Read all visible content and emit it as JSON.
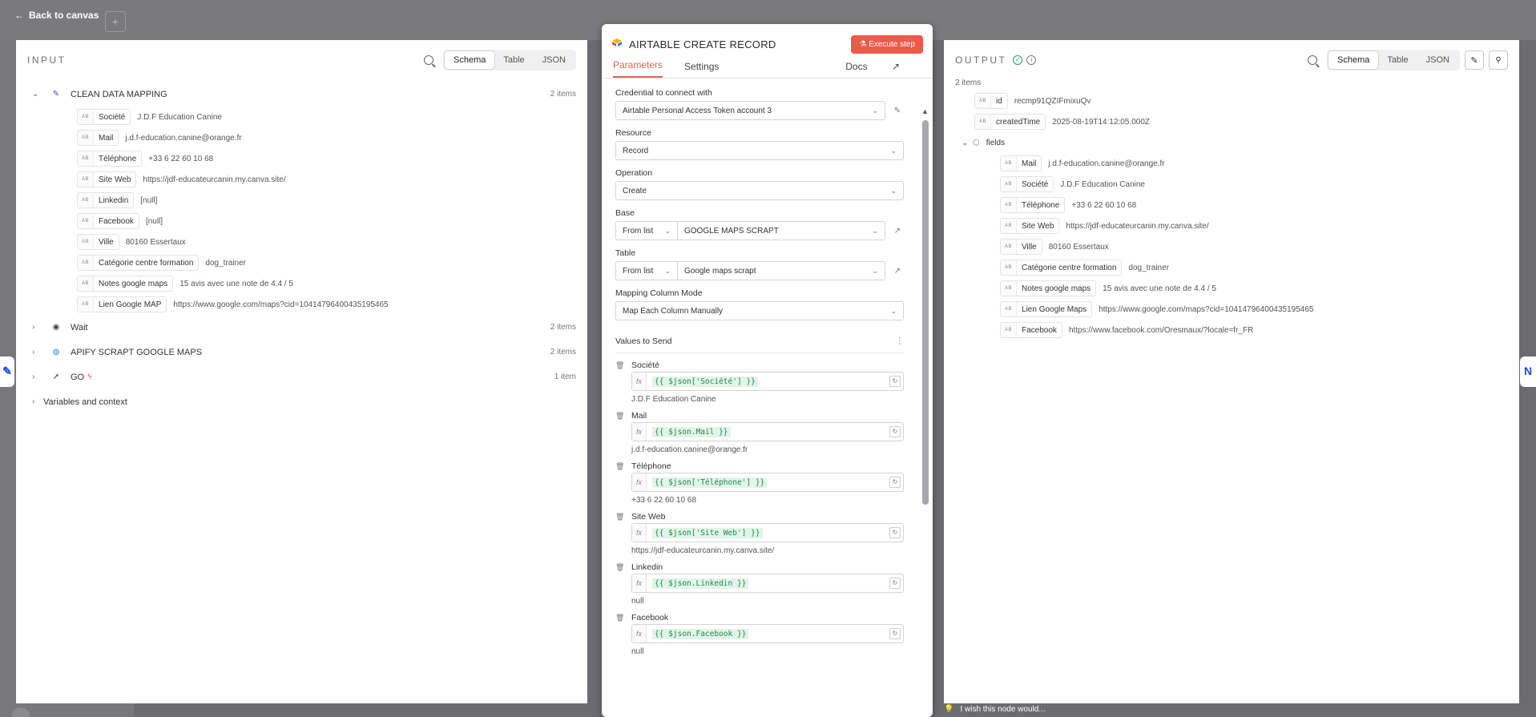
{
  "nav": {
    "back_label": "Back to canvas"
  },
  "input": {
    "title": "INPUT",
    "view_tabs": [
      "Schema",
      "Table",
      "JSON"
    ],
    "active_tab": "Schema",
    "nodes": [
      {
        "name": "CLEAN DATA MAPPING",
        "count": "2 items",
        "expanded": true,
        "icon": "pencil-icon",
        "fields": [
          {
            "key": "Société",
            "value": "J.D.F Education Canine"
          },
          {
            "key": "Mail",
            "value": "j.d.f-education.canine@orange.fr"
          },
          {
            "key": "Téléphone",
            "value": "+33 6 22 60 10 68"
          },
          {
            "key": "Site Web",
            "value": "https://jdf-educateurcanin.my.canva.site/"
          },
          {
            "key": "Linkedin",
            "value": "[null]"
          },
          {
            "key": "Facebook",
            "value": "[null]"
          },
          {
            "key": "Ville",
            "value": "80160 Essertaux"
          },
          {
            "key": "Catégorie centre formation",
            "value": "dog_trainer"
          },
          {
            "key": "Notes google maps",
            "value": "15 avis avec une note de 4.4 / 5"
          },
          {
            "key": "Lien Google MAP",
            "value": "https://www.google.com/maps?cid=10414796400435195465"
          }
        ]
      },
      {
        "name": "Wait",
        "count": "2 items",
        "icon": "wait-icon"
      },
      {
        "name": "APIFY SCRAPT GOOGLE MAPS",
        "count": "2 items",
        "icon": "globe-icon"
      },
      {
        "name": "GO",
        "count": "1 item",
        "icon": "cursor-icon"
      }
    ],
    "variables_label": "Variables and context"
  },
  "node": {
    "title": "AIRTABLE CREATE RECORD",
    "execute_label": "Execute step",
    "tabs": [
      "Parameters",
      "Settings"
    ],
    "docs_label": "Docs",
    "credential_label": "Credential to connect with",
    "credential_value": "Airtable Personal Access Token account 3",
    "resource_label": "Resource",
    "resource_value": "Record",
    "operation_label": "Operation",
    "operation_value": "Create",
    "base_label": "Base",
    "base_mode": "From list",
    "base_value": "GOOGLE MAPS SCRAPT",
    "table_label": "Table",
    "table_mode": "From list",
    "table_value": "Google maps scrapt",
    "mapping_label": "Mapping Column Mode",
    "mapping_value": "Map Each Column Manually",
    "values_label": "Values to Send",
    "values": [
      {
        "name": "Société",
        "expr": "{{ $json['Société'] }}",
        "preview": "J.D.F Education Canine"
      },
      {
        "name": "Mail",
        "expr": "{{ $json.Mail }}",
        "preview": "j.d.f-education.canine@orange.fr"
      },
      {
        "name": "Téléphone",
        "expr": "{{ $json['Téléphone'] }}",
        "preview": "+33 6 22 60 10 68"
      },
      {
        "name": "Site Web",
        "expr": "{{ $json['Site Web'] }}",
        "preview": "https://jdf-educateurcanin.my.canva.site/"
      },
      {
        "name": "Linkedin",
        "expr": "{{ $json.Linkedin }}",
        "preview": "null"
      },
      {
        "name": "Facebook",
        "expr": "{{ $json.Facebook }}",
        "preview": "null"
      }
    ]
  },
  "output": {
    "title": "OUTPUT",
    "view_tabs": [
      "Schema",
      "Table",
      "JSON"
    ],
    "active_tab": "Schema",
    "items_count": "2 items",
    "top_fields": [
      {
        "key": "id",
        "value": "recmp91QZIFmixuQv"
      },
      {
        "key": "createdTime",
        "value": "2025-08-19T14:12:05.000Z"
      }
    ],
    "fields_label": "fields",
    "fields": [
      {
        "key": "Mail",
        "value": "j.d.f-education.canine@orange.fr"
      },
      {
        "key": "Société",
        "value": "J.D.F Education Canine"
      },
      {
        "key": "Téléphone",
        "value": "+33 6 22 60 10 68"
      },
      {
        "key": "Site Web",
        "value": "https://jdf-educateurcanin.my.canva.site/"
      },
      {
        "key": "Ville",
        "value": "80160 Essertaux"
      },
      {
        "key": "Catégorie centre formation",
        "value": "dog_trainer"
      },
      {
        "key": "Notes google maps",
        "value": "15 avis avec une note de 4.4 / 5"
      },
      {
        "key": "Lien Google Maps",
        "value": "https://www.google.com/maps?cid=10414796400435195465"
      },
      {
        "key": "Facebook",
        "value": "https://www.facebook.com/Oresmaux/?locale=fr_FR"
      }
    ],
    "feedback_label": "I wish this node would..."
  },
  "field_type_badge": "AB",
  "colors": {
    "accent": "#e8634f",
    "execute": "#ee5a4a",
    "success": "#27a05a",
    "expr_bg": "#e2f4e8",
    "expr_fg": "#1f8a4c"
  }
}
